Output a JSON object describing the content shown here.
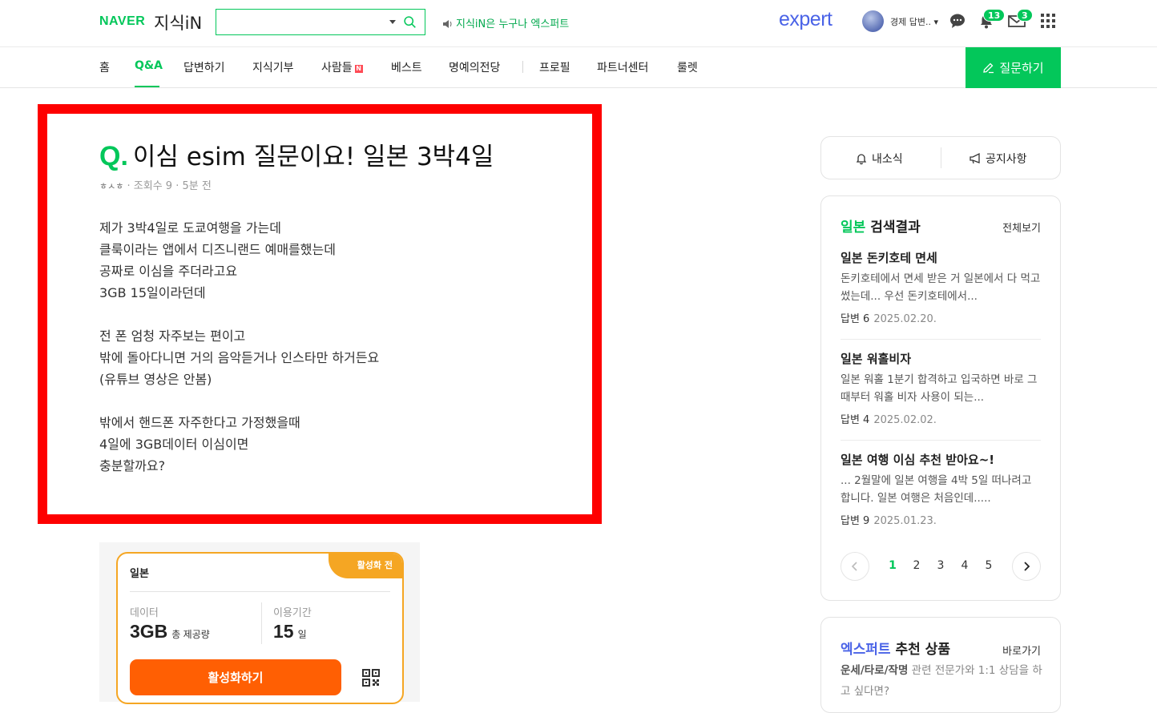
{
  "header": {
    "brand": "NAVER",
    "service": "지식iN",
    "search_placeholder": "",
    "promo": "지식iN은 누구나 엑스퍼트",
    "expert_logo": "expert",
    "user_label": "경제 답변..",
    "notify_count": "13",
    "mail_count": "3"
  },
  "nav": {
    "items": [
      "홈",
      "Q&A",
      "답변하기",
      "지식기부",
      "사람들",
      "베스트",
      "명예의전당",
      "프로필",
      "파트너센터",
      "룰렛"
    ],
    "new_badge": "N",
    "ask_button": "질문하기"
  },
  "question": {
    "q_mark": "Q.",
    "title": "이심 esim 질문이요! 일본 3박4일",
    "author": "ㅎㅅㅎ",
    "views": "조회수 9",
    "time": "5분 전",
    "body": {
      "p1": [
        "제가 3박4일로 도쿄여행을 가는데",
        "클룩이라는 앱에서 디즈니랜드 예매를했는데",
        "공짜로 이심을 주더라고요",
        "3GB 15일이라던데"
      ],
      "p2": [
        "전 폰 엄청 자주보는 편이고",
        "밖에 돌아다니면 거의 음악듣거나 인스타만 하거든요",
        "(유튜브 영상은 안봄)"
      ],
      "p3": [
        "밖에서 핸드폰 자주한다고 가정했을때",
        "4일에 3GB데이터 이심이면",
        "충분할까요?"
      ]
    }
  },
  "esim": {
    "status": "활성화 전",
    "country": "일본",
    "data_label": "데이터",
    "data_value": "3GB",
    "data_unit": "총 제공량",
    "period_label": "이용기간",
    "period_value": "15",
    "period_unit": "일",
    "activate_button": "활성화하기"
  },
  "sidebar": {
    "tabs": [
      "내소식",
      "공지사항"
    ],
    "results": {
      "keyword": "일본",
      "title_suffix": " 검색결과",
      "more": "전체보기",
      "items": [
        {
          "title": "일본 돈키호테 면세",
          "desc": "돈키호테에서 면세 받은 거 일본에서 다 먹고 썼는데... 우선 돈키호테에서...",
          "answers": "답변 6",
          "date": "2025.02.20."
        },
        {
          "title": "일본 워홀비자",
          "desc": "일본 워홀 1분기 합격하고 입국하면 바로 그때부터 워홀 비자 사용이 되는...",
          "answers": "답변 4",
          "date": "2025.02.02."
        },
        {
          "title": "일본 여행 이심 추천 받아요~!",
          "desc": "... 2월말에 일본 여행을 4박 5일 떠나려고 합니다. 일본 여행은 처음인데.....",
          "answers": "답변 9",
          "date": "2025.01.23."
        }
      ],
      "pages": [
        "1",
        "2",
        "3",
        "4",
        "5"
      ]
    },
    "expert": {
      "brand": "엑스퍼트",
      "title_suffix": " 추천 상품",
      "more": "바로가기",
      "desc_bold": "운세/타로/작명",
      "desc_rest": " 관련 전문가와 1:1 상담을 하고 싶다면?"
    }
  },
  "colors": {
    "naver_green": "#03c75a",
    "frame_red": "#fe0000",
    "expert_blue": "#4a63e7",
    "esim_orange": "#f5a623",
    "activate_orange": "#ff5f03"
  }
}
